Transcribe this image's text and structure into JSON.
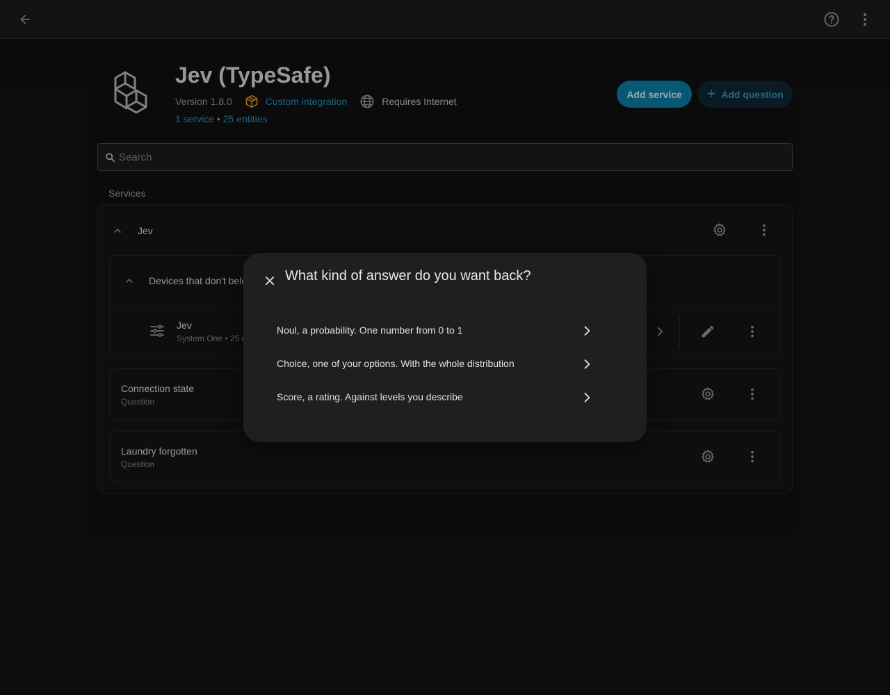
{
  "app": {
    "title": "Jev (TypeSafe)",
    "version": "Version 1.8.0",
    "custom_integration": "Custom integration",
    "requires_internet": "Requires Internet",
    "services_link": "1 service",
    "separator": " • ",
    "entities_link": "25 entities",
    "add_service_label": "Add service",
    "add_question_label": "Add question"
  },
  "search": {
    "placeholder": "Search",
    "value": ""
  },
  "services": {
    "section_label": "Services",
    "group_name": "Jev",
    "subgroup_label": "Devices that don't belc",
    "device": {
      "name": "Jev",
      "subtitle": "System One • 25 e"
    },
    "items": [
      {
        "name": "Connection state",
        "type": "Question"
      },
      {
        "name": "Laundry forgotten",
        "type": "Question"
      }
    ]
  },
  "dialog": {
    "title": "What kind of answer do you want back?",
    "options": [
      "Noul, a probability. One number from 0 to 1",
      "Choice, one of your options. With the whole distribution",
      "Score, a rating. Against levels you describe"
    ]
  },
  "colors": {
    "accent": "#0a82ad",
    "link": "#2c92c4",
    "custom_integration_icon": "#f0a020",
    "background": "#111111",
    "dialog": "#1f1f1f"
  },
  "icons": {
    "back": "arrow-left-icon",
    "help": "help-circle-icon",
    "menu": "dots-vertical-icon",
    "search": "search-icon",
    "settings": "gear-icon",
    "edit": "pencil-icon",
    "close": "close-icon",
    "chevron": "chevron-right-icon",
    "collapse": "chevron-up-icon"
  }
}
